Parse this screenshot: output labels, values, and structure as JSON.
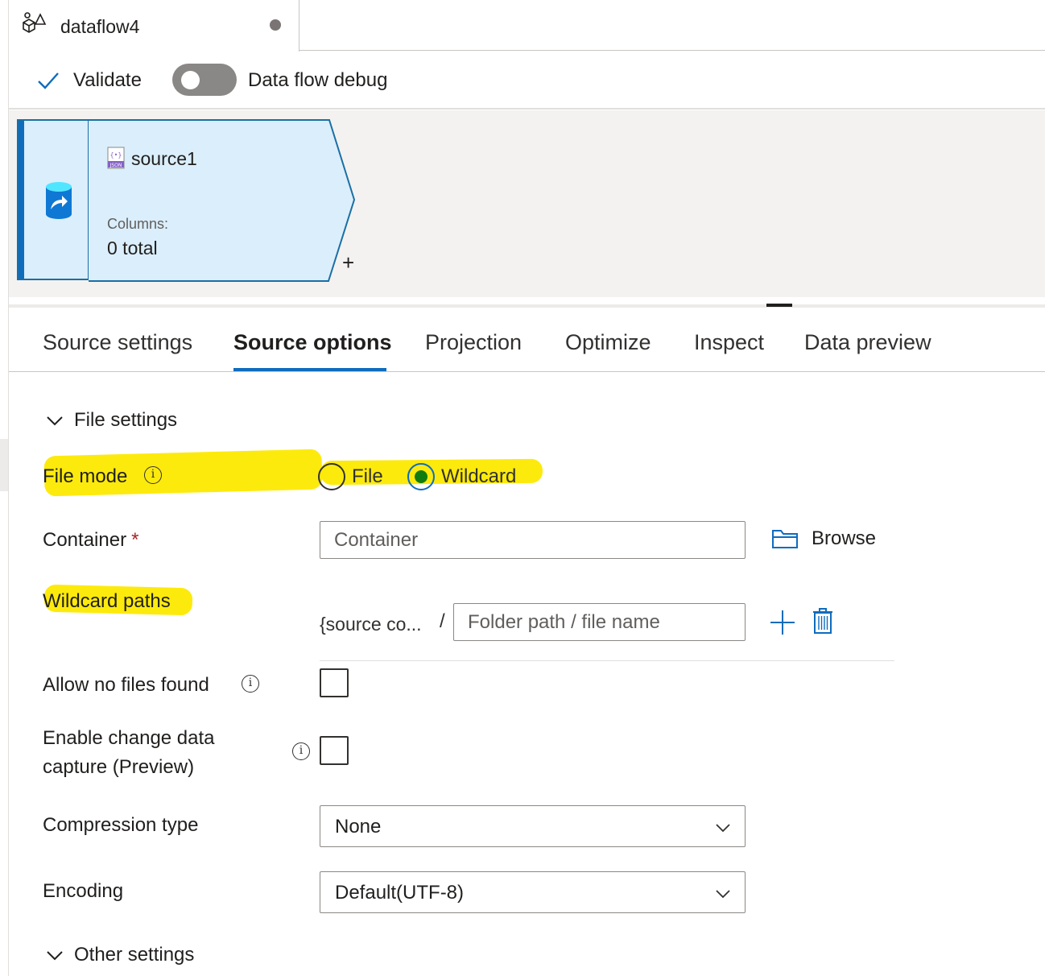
{
  "document_tab": {
    "title": "dataflow4",
    "icon": "dataflow-icon"
  },
  "toolbar": {
    "validate_label": "Validate",
    "debug_label": "Data flow debug",
    "debug_on": false
  },
  "node": {
    "title": "source1",
    "columns_label": "Columns:",
    "columns_value": "0 total",
    "icon": "json-file-icon"
  },
  "tabs": [
    {
      "label": "Source settings"
    },
    {
      "label": "Source options"
    },
    {
      "label": "Projection"
    },
    {
      "label": "Optimize"
    },
    {
      "label": "Inspect"
    },
    {
      "label": "Data preview"
    }
  ],
  "active_tab": "Source options",
  "file_settings": {
    "header": "File settings",
    "file_mode": {
      "label": "File mode",
      "options": [
        "File",
        "Wildcard"
      ],
      "selected": "Wildcard"
    },
    "container": {
      "label": "Container",
      "required_mark": "*",
      "placeholder": "Container",
      "browse_label": "Browse"
    },
    "wildcard_paths": {
      "label": "Wildcard paths",
      "prefix": "{source co...",
      "separator": "/",
      "placeholder": "Folder path / file name"
    },
    "allow_no_files": {
      "label": "Allow no files found",
      "checked": false
    },
    "change_data_capture": {
      "label_line1": "Enable change data",
      "label_line2": "capture (Preview)",
      "checked": false
    },
    "compression": {
      "label": "Compression type",
      "value": "None"
    },
    "encoding": {
      "label": "Encoding",
      "value": "Default(UTF-8)"
    }
  },
  "other_settings": {
    "header": "Other settings"
  },
  "colors": {
    "accent": "#0f6cbd",
    "highlight": "#fde900",
    "radio_selected": "#107c10",
    "node_fill": "#dbeefb"
  }
}
